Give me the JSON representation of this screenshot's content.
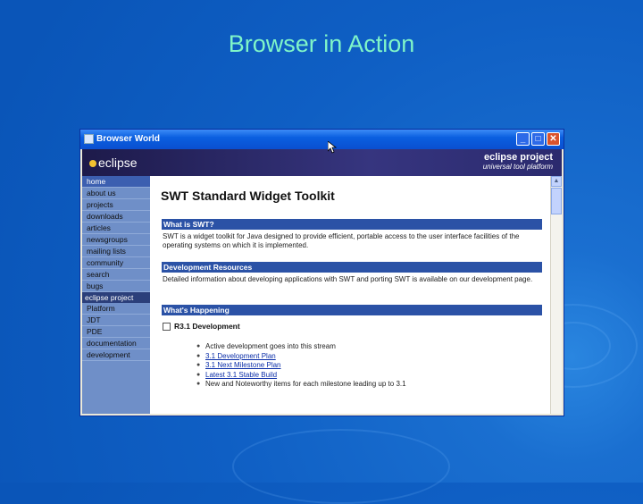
{
  "slide": {
    "title": "Browser in Action"
  },
  "window": {
    "title": "Browser World",
    "minimize": "_",
    "maximize": "□",
    "close": "✕"
  },
  "banner": {
    "logo": "eclipse",
    "brand_name": "eclipse project",
    "brand_tag": "universal tool platform"
  },
  "sidebar": {
    "items": [
      "home",
      "about us",
      "projects",
      "downloads",
      "articles",
      "newsgroups",
      "mailing lists",
      "community",
      "search",
      "bugs"
    ],
    "heading": "eclipse project",
    "project_items": [
      "Platform",
      "JDT",
      "PDE",
      "documentation",
      "development"
    ]
  },
  "content": {
    "title": "SWT Standard Widget Toolkit",
    "sections": [
      {
        "heading": "What is SWT?",
        "text": "SWT is a widget toolkit for Java designed to provide efficient, portable access to the user interface facilities of the operating systems on which it is implemented."
      },
      {
        "heading": "Development Resources",
        "text": "Detailed information about developing applications with SWT and porting SWT is available on our development page."
      },
      {
        "heading": "What's Happening"
      }
    ],
    "subheading": "R3.1 Development",
    "bullets": [
      "Active development goes into this stream",
      "3.1 Development Plan",
      "3.1 Next Milestone Plan",
      "Latest 3.1 Stable Build",
      "New and Noteworthy items for each milestone leading up to 3.1"
    ]
  },
  "colors": {
    "title_text": "#7ff5c8",
    "section_bar": "#2b52a6",
    "sidebar": "#6f8fc8"
  }
}
